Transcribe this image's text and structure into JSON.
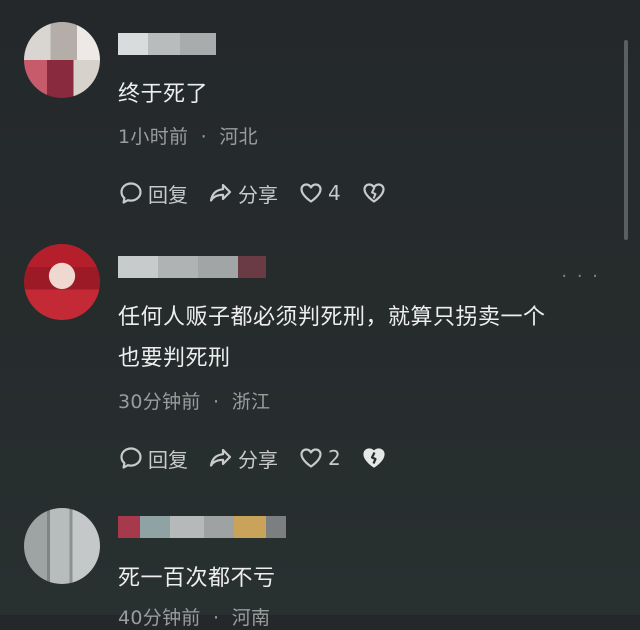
{
  "comments": [
    {
      "text_lines": [
        "终于死了"
      ],
      "time": "1小时前",
      "location": "河北",
      "reply_label": "回复",
      "share_label": "分享",
      "like_count": "4"
    },
    {
      "text_lines": [
        "任何人贩子都必须判死刑，就算只拐卖一个",
        "也要判死刑"
      ],
      "time": "30分钟前",
      "location": "浙江",
      "reply_label": "回复",
      "share_label": "分享",
      "like_count": "2",
      "more_label": "· · ·"
    },
    {
      "text_lines": [
        "死一百次都不亏"
      ],
      "time": "40分钟前",
      "location": "河南"
    }
  ],
  "meta_separator": "·",
  "icons": {
    "reply": "reply-bubble-icon",
    "share": "share-arrow-icon",
    "like": "heart-icon",
    "dislike": "broken-heart-icon",
    "more": "more-dots-icon"
  },
  "colors": {
    "background": "#262b2c",
    "text": "#eeeeee",
    "meta": "#9a9c9d",
    "action": "#c9cacb"
  }
}
